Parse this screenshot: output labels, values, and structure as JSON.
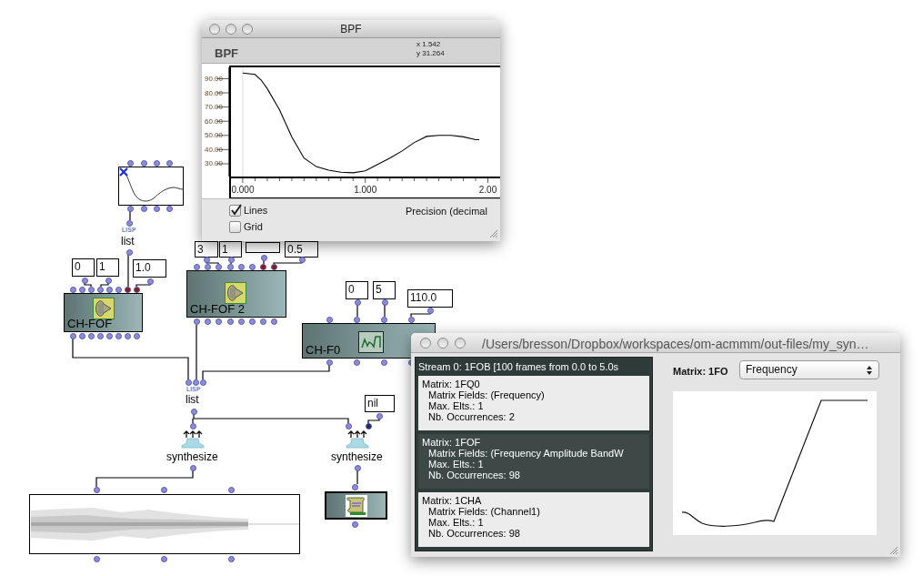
{
  "patch": {
    "number_boxes": [
      {
        "value": "0"
      },
      {
        "value": "1"
      },
      {
        "value": "1.0"
      },
      {
        "value": "3"
      },
      {
        "value": "1"
      },
      {
        "value": "0.5"
      },
      {
        "value": "0"
      },
      {
        "value": "5"
      },
      {
        "value": "110.0"
      },
      {
        "value": "nil"
      }
    ],
    "nodes": [
      {
        "kind": "bpf"
      },
      {
        "kind": "lisp",
        "badge": "LISP",
        "label": "list"
      },
      {
        "kind": "class",
        "label": "CH-FOF",
        "inlets": [
          {
            "color": "#8c8cdc"
          },
          {
            "color": "#8c8cdc"
          },
          {
            "color": "#8c8cdc"
          },
          {
            "color": "#8c8cdc"
          },
          {
            "color": "#8c8cdc"
          },
          {
            "color": "#8c8cdc"
          },
          {
            "color": "#8b1a1a"
          },
          {
            "color": "#8b1a1a"
          }
        ]
      },
      {
        "kind": "class",
        "label": "CH-FOF 2",
        "inlets": [
          {
            "color": "#8c8cdc"
          },
          {
            "color": "#8c8cdc"
          },
          {
            "color": "#8c8cdc"
          },
          {
            "color": "#8c8cdc"
          },
          {
            "color": "#8c8cdc"
          },
          {
            "color": "#8c8cdc"
          },
          {
            "color": "#8b1a1a"
          },
          {
            "color": "#8b1a1a"
          }
        ]
      },
      {
        "kind": "class",
        "label": "CH-F0"
      },
      {
        "kind": "lisp",
        "badge": "LISP",
        "label": "list"
      },
      {
        "kind": "function",
        "label": "synthesize"
      },
      {
        "kind": "function",
        "label": "synthesize",
        "inlets": [
          {
            "color": "#8c8cdc"
          },
          {
            "color": "#1f2b66"
          }
        ]
      },
      {
        "kind": "sound"
      },
      {
        "kind": "sdif"
      }
    ]
  },
  "bpf_window": {
    "title": "BPF",
    "header": "BPF",
    "cursor_x": "x 1.542",
    "cursor_y": "y 31.264",
    "chart_data": {
      "type": "line",
      "x": [
        0,
        0.1,
        0.15,
        0.2,
        0.3,
        0.4,
        0.5,
        0.6,
        0.7,
        0.8,
        0.9,
        1.0,
        1.1,
        1.2,
        1.3,
        1.4,
        1.5,
        1.6,
        1.7,
        1.8,
        1.9,
        1.93
      ],
      "series": [
        {
          "color": "#000000",
          "values": [
            94,
            93,
            89,
            83,
            68,
            49,
            34,
            28,
            25.5,
            24,
            23.6,
            25,
            29.5,
            34,
            39,
            45,
            49.3,
            50,
            50,
            49,
            47,
            47
          ]
        }
      ],
      "xlim": [
        -0.096,
        2.1
      ],
      "ylim": [
        21,
        98
      ],
      "xticks": [
        {
          "value": 0,
          "label": "0.000"
        },
        {
          "value": 1,
          "label": "1.000"
        },
        {
          "value": 2,
          "label": "2.00"
        }
      ],
      "yticks": [
        {
          "value": 30,
          "label": "30.00"
        },
        {
          "value": 40,
          "label": "40.00"
        },
        {
          "value": 50,
          "label": "50.00"
        },
        {
          "value": 60,
          "label": "60.00"
        },
        {
          "value": 70,
          "label": "70.00"
        },
        {
          "value": 80,
          "label": "80.00"
        },
        {
          "value": 90,
          "label": "90.00"
        }
      ]
    },
    "options": [
      {
        "label": "Lines",
        "checked": true
      },
      {
        "label": "Grid",
        "checked": false
      }
    ],
    "precision_label": "Precision (decimal"
  },
  "sdif_window": {
    "title": "/Users/bresson/Dropbox/workspaces/om-acmmm/out-files/my_syn…",
    "stream": "Stream 0: 1FOB [100 frames from 0.0 to 5.0s",
    "matrices": [
      {
        "name": "Matrix: 1FQ0",
        "fields": "Matrix Fields: (Frequency)",
        "max_elts": "Max. Elts.: 1",
        "occurrences": "Nb. Occurrences: 2",
        "selected": false
      },
      {
        "name": "Matrix: 1FOF",
        "fields": "Matrix Fields: (Frequency Amplitude BandW",
        "max_elts": "Max. Elts.: 1",
        "occurrences": "Nb. Occurrences: 98",
        "selected": true
      },
      {
        "name": "Matrix: 1CHA",
        "fields": "Matrix Fields: (Channel1)",
        "max_elts": "Max. Elts.: 1",
        "occurrences": "Nb. Occurrences: 98",
        "selected": false
      }
    ],
    "matrix_label": "Matrix: 1FO",
    "field_select": "Frequency"
  }
}
